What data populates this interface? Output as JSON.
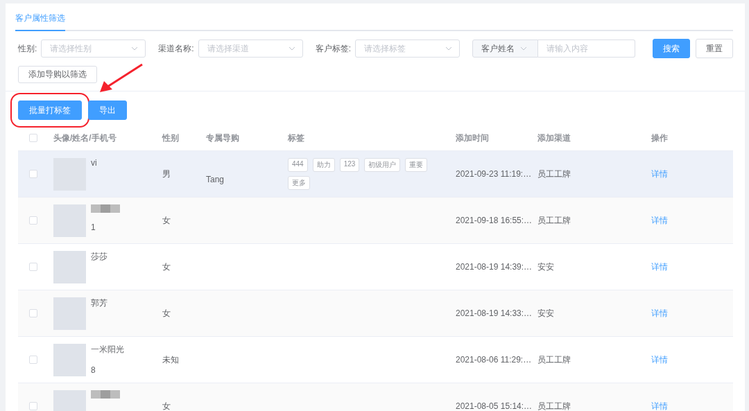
{
  "tabs": [
    {
      "label": "客户属性筛选",
      "selected": true
    }
  ],
  "filters": [
    {
      "label": "性别:",
      "placeholder": "请选择性别"
    },
    {
      "label": "渠道名称:",
      "placeholder": "请选择渠道"
    },
    {
      "label": "客户标签:",
      "placeholder": "请选择标签"
    }
  ],
  "search": {
    "field_select": "客户姓名",
    "placeholder": "请输入内容"
  },
  "search_button": "搜索",
  "reset_button": "重置",
  "add_guide_button": "添加导购以筛选",
  "actions": [
    {
      "label": "批量打标签",
      "annotated": true
    },
    {
      "label": "导出",
      "annotated": false
    }
  ],
  "table": {
    "select_all_checked": false,
    "columns": [
      "头像/姓名/手机号",
      "性别",
      "专属导购",
      "标签",
      "添加时间",
      "添加渠道",
      "操作"
    ],
    "rows": [
      {
        "checked": false,
        "highlighted": true,
        "name": "vi",
        "phone": "",
        "blurred": false,
        "gender": "男",
        "guide": "Tang",
        "tags": [
          "444",
          "助力",
          "123",
          "初级用户",
          "重要"
        ],
        "more": "更多",
        "time": "2021-09-23 11:19:…",
        "channel": "员工工牌",
        "action": "详情"
      },
      {
        "checked": false,
        "highlighted": false,
        "name": "",
        "phone": "1",
        "blurred": true,
        "gender": "女",
        "guide": "",
        "tags": [],
        "more": "",
        "time": "2021-09-18 16:55:…",
        "channel": "员工工牌",
        "action": "详情"
      },
      {
        "checked": false,
        "highlighted": false,
        "name": "莎莎",
        "phone": "",
        "blurred": false,
        "gender": "女",
        "guide": "",
        "tags": [],
        "more": "",
        "time": "2021-08-19 14:39:…",
        "channel": "安安",
        "action": "详情"
      },
      {
        "checked": false,
        "highlighted": false,
        "name": "郭芳",
        "phone": "",
        "blurred": false,
        "gender": "女",
        "guide": "",
        "tags": [],
        "more": "",
        "time": "2021-08-19 14:33:…",
        "channel": "安安",
        "action": "详情"
      },
      {
        "checked": false,
        "highlighted": false,
        "name": "一米阳光",
        "phone": "8",
        "blurred": false,
        "gender": "未知",
        "guide": "",
        "tags": [],
        "more": "",
        "time": "2021-08-06 11:29:…",
        "channel": "员工工牌",
        "action": "详情"
      },
      {
        "checked": false,
        "highlighted": false,
        "name": "",
        "phone": "",
        "blurred": true,
        "gender": "女",
        "guide": "",
        "tags": [],
        "more": "",
        "time": "2021-08-05 15:14:…",
        "channel": "员工工牌",
        "action": "详情"
      }
    ]
  }
}
